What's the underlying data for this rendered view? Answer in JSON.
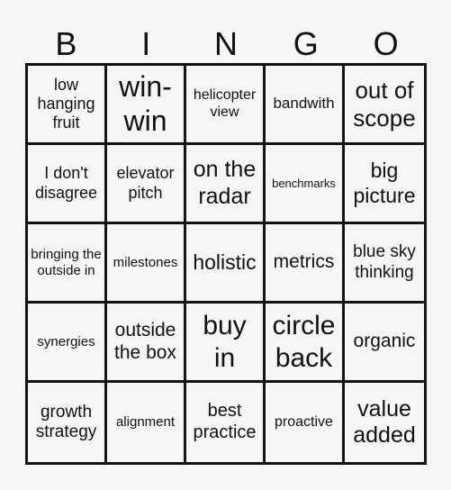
{
  "header": {
    "letters": [
      "B",
      "I",
      "N",
      "G",
      "O"
    ]
  },
  "board": {
    "rows": [
      [
        "low hanging fruit",
        "win-win",
        "helicopter view",
        "bandwith",
        "out of scope"
      ],
      [
        "I don't disagree",
        "elevator pitch",
        "on the radar",
        "benchmarks",
        "big picture"
      ],
      [
        "bringing the outside in",
        "milestones",
        "holistic",
        "metrics",
        "blue sky thinking"
      ],
      [
        "synergies",
        "outside the box",
        "buy in",
        "circle back",
        "organic"
      ],
      [
        "growth strategy",
        "alignment",
        "best practice",
        "proactive",
        "value added"
      ]
    ]
  },
  "colors": {
    "background": "#f6f6f6",
    "grid_lines": "#141414",
    "text": "#111111"
  }
}
